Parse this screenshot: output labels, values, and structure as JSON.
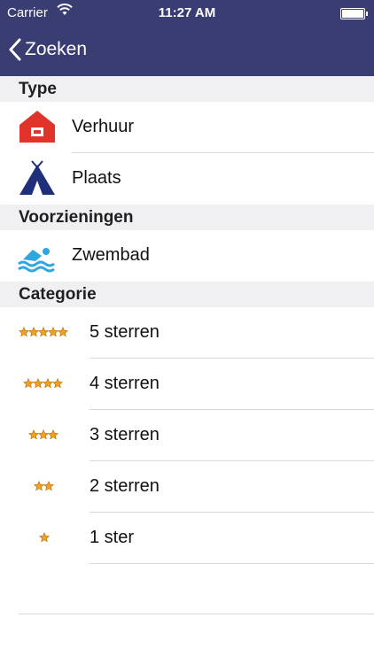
{
  "status_bar": {
    "carrier": "Carrier",
    "time": "11:27 AM"
  },
  "nav": {
    "back_label": "Zoeken"
  },
  "sections": {
    "type": {
      "header": "Type",
      "items": [
        {
          "label": "Verhuur",
          "icon": "house-icon",
          "color": "#e0342b"
        },
        {
          "label": "Plaats",
          "icon": "tent-icon",
          "color": "#1f2f7a"
        }
      ]
    },
    "voorzieningen": {
      "header": "Voorzieningen",
      "items": [
        {
          "label": "Zwembad",
          "icon": "swimming-icon",
          "color": "#2ea6de"
        }
      ]
    },
    "categorie": {
      "header": "Categorie",
      "items": [
        {
          "label": "5 sterren",
          "stars": 5
        },
        {
          "label": "4 sterren",
          "stars": 4
        },
        {
          "label": "3 sterren",
          "stars": 3
        },
        {
          "label": "2 sterren",
          "stars": 2
        },
        {
          "label": "1 ster",
          "stars": 1
        }
      ]
    }
  },
  "colors": {
    "nav_bar": "#3a3d72",
    "section_bg": "#f0f0f2",
    "star": "#f2a021"
  }
}
